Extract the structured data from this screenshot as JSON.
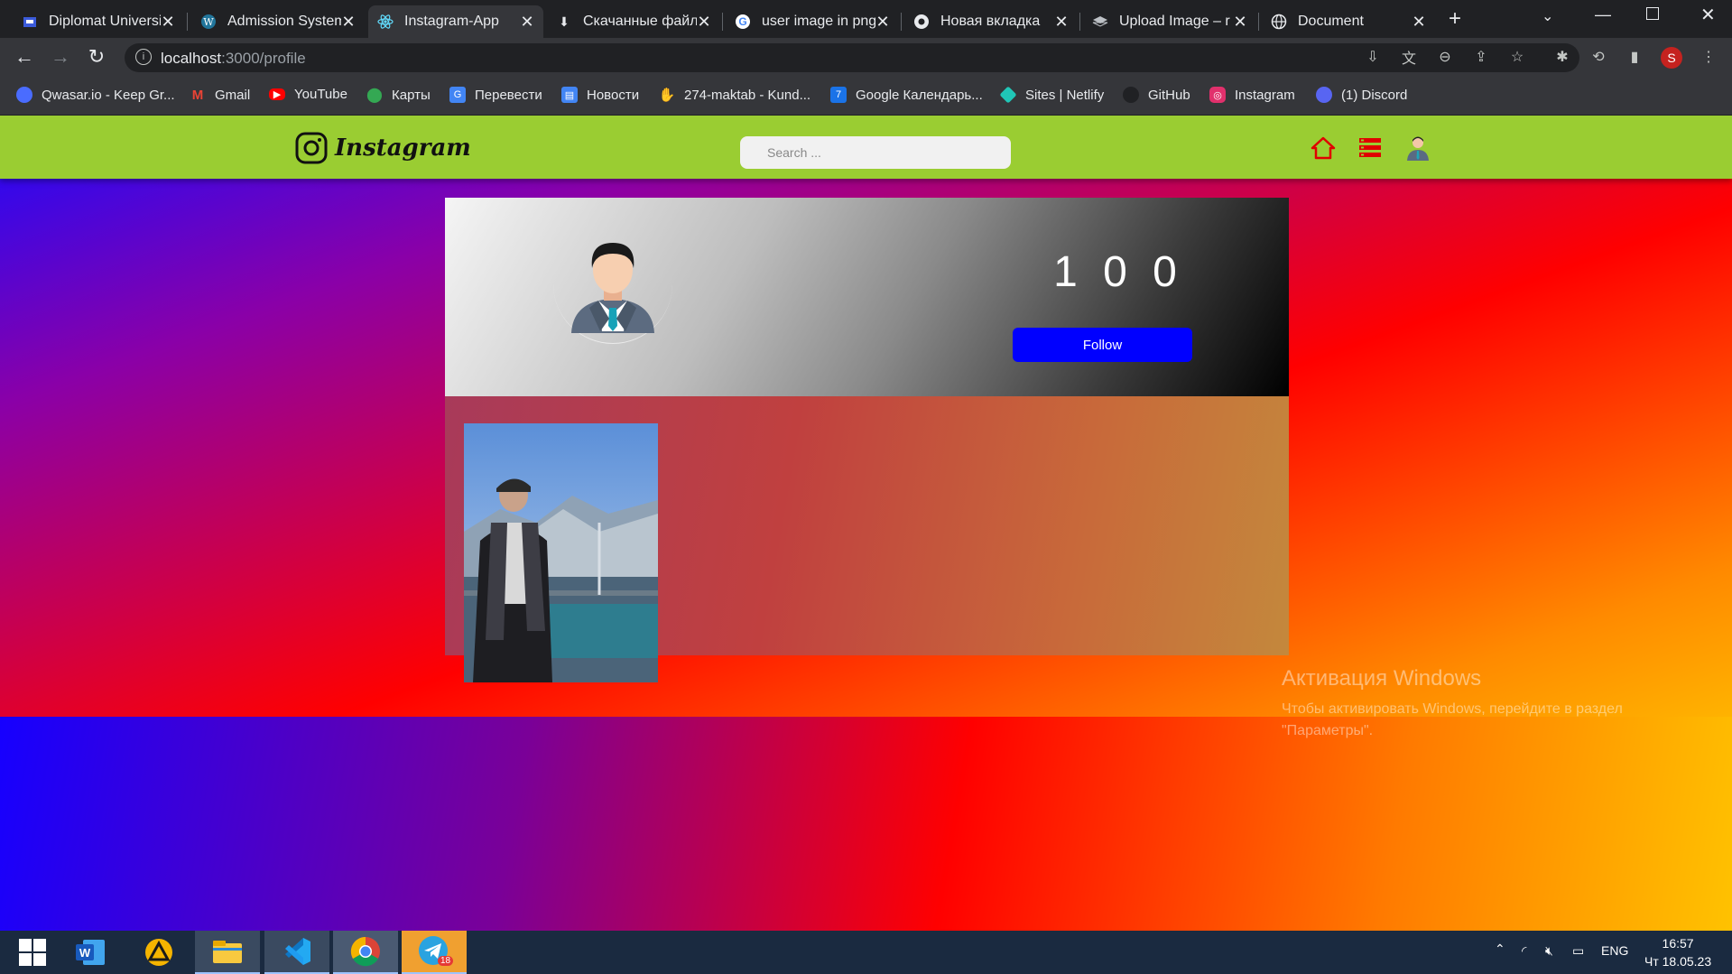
{
  "browser": {
    "tabs": [
      {
        "title": "Diplomat Universi",
        "icon": "university-favicon"
      },
      {
        "title": "Admission System",
        "icon": "wordpress-favicon"
      },
      {
        "title": "Instagram-App",
        "icon": "react-favicon",
        "active": true
      },
      {
        "title": "Скачанные файлы",
        "icon": "download-icon"
      },
      {
        "title": "user image in png",
        "icon": "google-favicon"
      },
      {
        "title": "Новая вкладка",
        "icon": "chrome-favicon"
      },
      {
        "title": "Upload Image – r",
        "icon": "layers-favicon"
      },
      {
        "title": "Document",
        "icon": "globe-favicon"
      }
    ],
    "new_tab_label": "+",
    "url_host": "localhost",
    "url_path": ":3000/profile",
    "profile_initial": "S",
    "bookmarks": [
      {
        "label": "Qwasar.io - Keep Gr...",
        "color": "#4a6cff"
      },
      {
        "label": "Gmail",
        "color": "#ea4335"
      },
      {
        "label": "YouTube",
        "color": "#ff0000"
      },
      {
        "label": "Карты",
        "color": "#34a853"
      },
      {
        "label": "Перевести",
        "color": "#4285f4"
      },
      {
        "label": "Новости",
        "color": "#4285f4"
      },
      {
        "label": "274-maktab - Kund...",
        "color": "#7a7aff"
      },
      {
        "label": "Google Календарь...",
        "color": "#1a73e8"
      },
      {
        "label": "Sites | Netlify",
        "color": "#20c6b7"
      },
      {
        "label": "GitHub",
        "color": "#333333"
      },
      {
        "label": "Instagram",
        "color": "#e1306c"
      },
      {
        "label": "(1) Discord",
        "color": "#5865f2"
      }
    ]
  },
  "app": {
    "logo_text": "Instagram",
    "search_placeholder": "Search ...",
    "nav_icons": [
      "home-icon",
      "menu-list-icon",
      "user-avatar-icon"
    ],
    "accent_color": "#9acd32",
    "profile": {
      "counts": [
        "1",
        "0",
        "0"
      ],
      "follow_label": "Follow"
    }
  },
  "windows_activation": {
    "title": "Активация Windows",
    "line1": "Чтобы активировать Windows, перейдите в раздел",
    "line2": "\"Параметры\"."
  },
  "taskbar": {
    "language": "ENG",
    "time": "16:57",
    "date": "Чт 18.05.23",
    "telegram_badge": "18"
  }
}
